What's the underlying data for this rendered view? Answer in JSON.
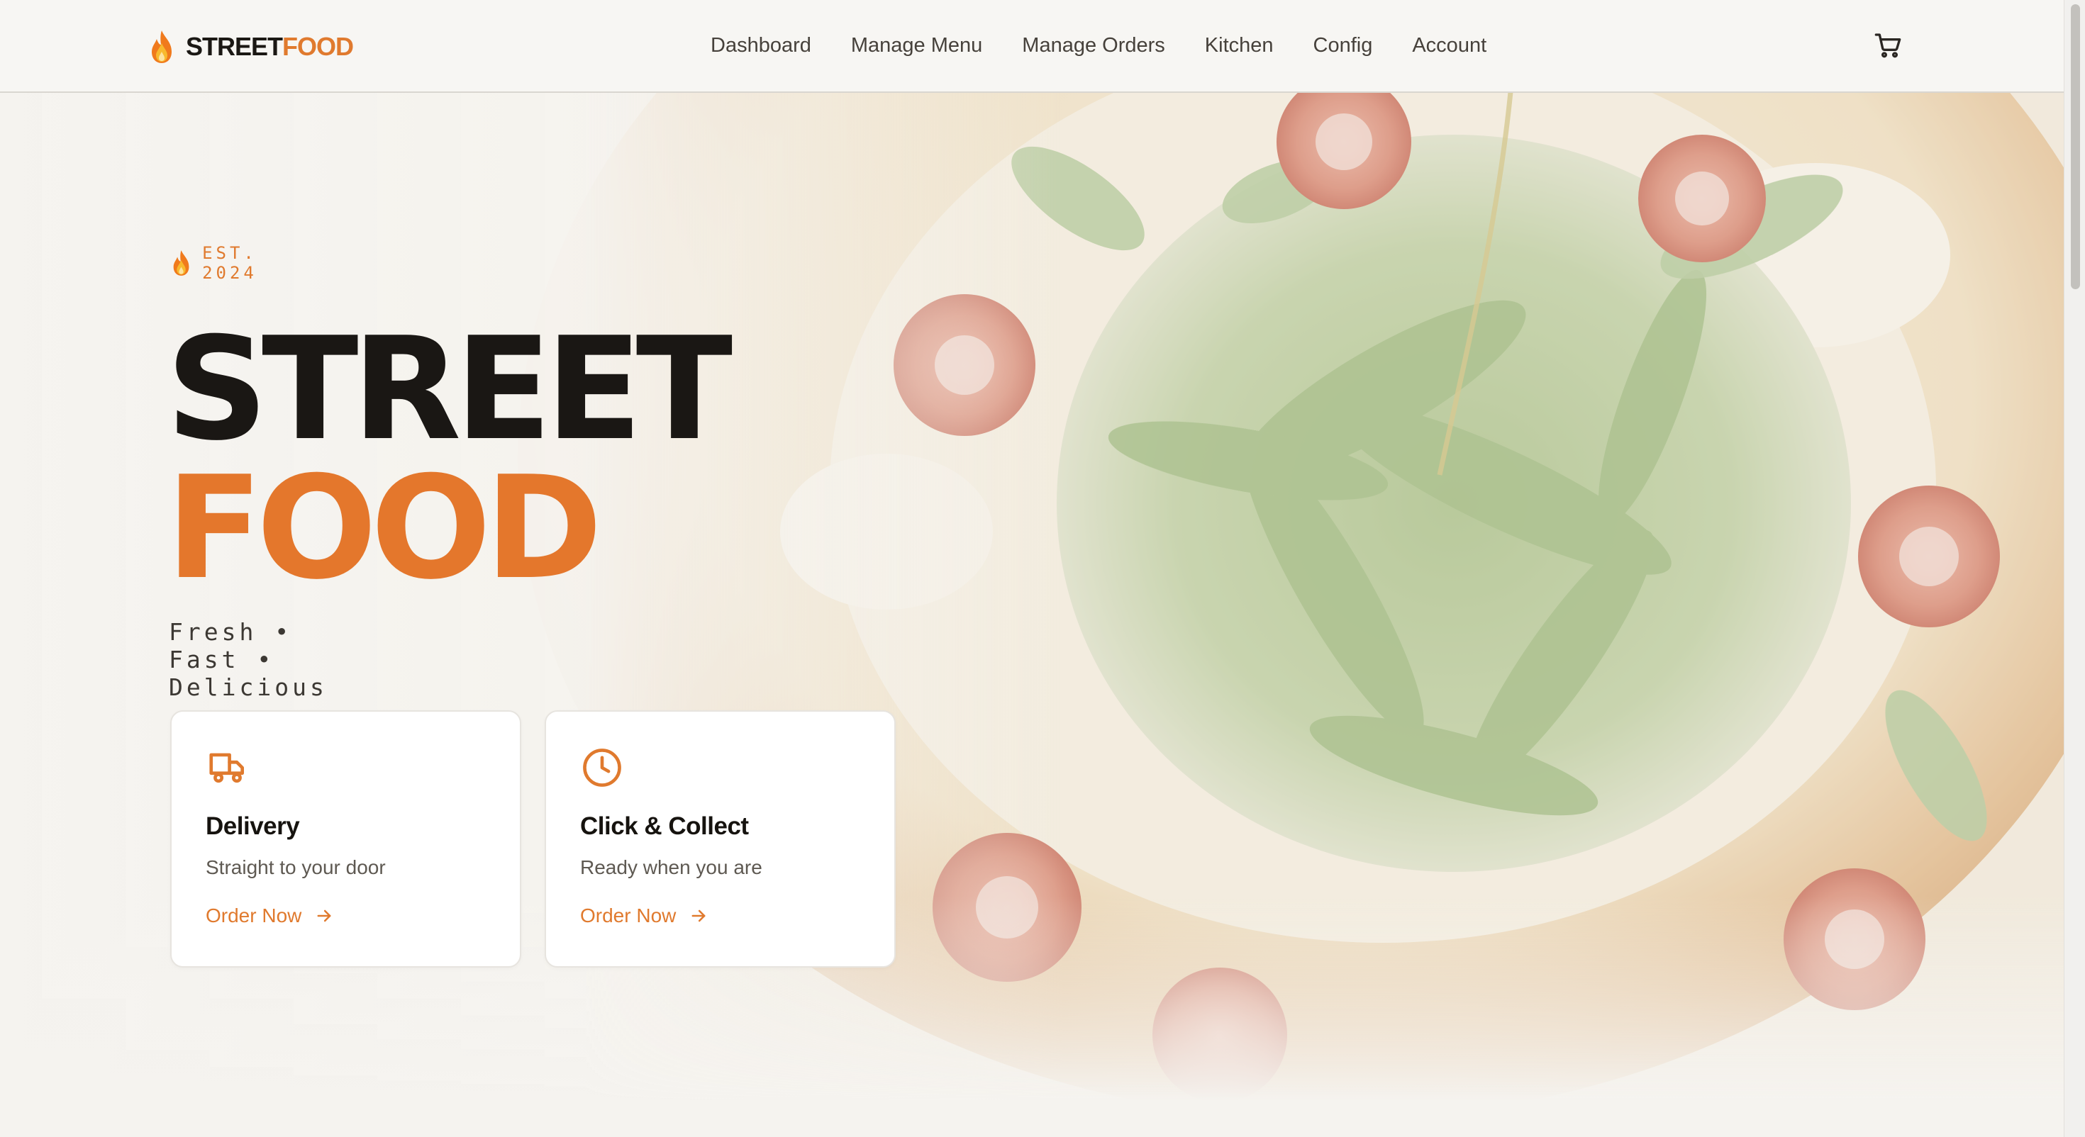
{
  "brand": {
    "name_part1": "STREET",
    "name_part2": "FOOD"
  },
  "nav": {
    "links": [
      "Dashboard",
      "Manage Menu",
      "Manage Orders",
      "Kitchen",
      "Config",
      "Account"
    ]
  },
  "icons": {
    "logo": "flame-icon",
    "cart": "shopping-cart-icon",
    "est": "flame-icon",
    "delivery": "truck-icon",
    "collect": "clock-icon",
    "cta": "arrow-right-icon"
  },
  "hero": {
    "est_label": "EST. 2024",
    "title_line1": "STREET",
    "title_line2": "FOOD",
    "tagline": "Fresh • Fast • Delicious"
  },
  "cards": [
    {
      "title": "Delivery",
      "subtitle": "Straight to your door",
      "cta": "Order Now"
    },
    {
      "title": "Click & Collect",
      "subtitle": "Ready when you are",
      "cta": "Order Now"
    }
  ],
  "colors": {
    "accent": "#e07a2e",
    "text_dark": "#1a1714",
    "background": "#f5f3ef",
    "card_bg": "#ffffff"
  }
}
